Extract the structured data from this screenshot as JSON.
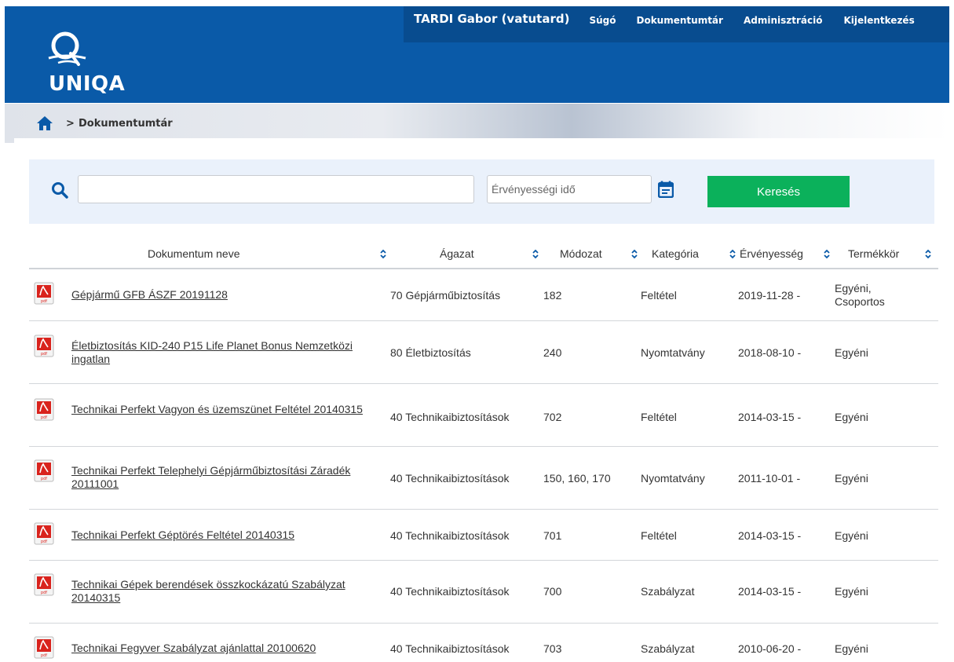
{
  "header": {
    "logo_text": "UNIQA",
    "user": "TARDI Gabor (vatutard)",
    "nav": [
      "Súgó",
      "Dokumentumtár",
      "Adminisztráció",
      "Kijelentkezés"
    ]
  },
  "breadcrumb": {
    "separator": ">",
    "current": "Dokumentumtár"
  },
  "search": {
    "query": "",
    "date_placeholder": "Érvényességi idő",
    "button_label": "Keresés"
  },
  "table": {
    "columns": [
      "Dokumentum neve",
      "Ágazat",
      "Módozat",
      "Kategória",
      "Érvényesség",
      "Termékkör"
    ],
    "rows": [
      {
        "name": "Gépjármű GFB ÁSZF 20191128",
        "agazat": "70 Gépjárműbiztosítás",
        "modozat": "182",
        "kategoria": "Feltétel",
        "ervenyesseg": "2019-11-28 -",
        "termekkor": "Egyéni, Csoportos"
      },
      {
        "name": "Életbiztosítás KID-240 P15 Life Planet Bonus Nemzetközi ingatlan",
        "agazat": "80 Életbiztosítás",
        "modozat": "240",
        "kategoria": "Nyomtatvány",
        "ervenyesseg": "2018-08-10 -",
        "termekkor": "Egyéni"
      },
      {
        "name": "Technikai Perfekt Vagyon és üzemszünet Feltétel 20140315",
        "agazat": "40 Technikaibiztosítások",
        "modozat": "702",
        "kategoria": "Feltétel",
        "ervenyesseg": "2014-03-15 -",
        "termekkor": "Egyéni"
      },
      {
        "name": "Technikai Perfekt Telephelyi Gépjárműbiztosítási Záradék 20111001",
        "agazat": "40 Technikaibiztosítások",
        "modozat": "150, 160, 170",
        "kategoria": "Nyomtatvány",
        "ervenyesseg": "2011-10-01 -",
        "termekkor": "Egyéni"
      },
      {
        "name": "Technikai Perfekt Géptörés Feltétel 20140315",
        "agazat": "40 Technikaibiztosítások",
        "modozat": "701",
        "kategoria": "Feltétel",
        "ervenyesseg": "2014-03-15 -",
        "termekkor": "Egyéni"
      },
      {
        "name": "Technikai Gépek berendések összkockázatú Szabályzat 20140315",
        "agazat": "40 Technikaibiztosítások",
        "modozat": "700",
        "kategoria": "Szabályzat",
        "ervenyesseg": "2014-03-15 -",
        "termekkor": "Egyéni"
      },
      {
        "name": "Technikai Fegyver Szabályzat ajánlattal 20100620",
        "agazat": "40 Technikaibiztosítások",
        "modozat": "703",
        "kategoria": "Szabályzat",
        "ervenyesseg": "2010-06-20 -",
        "termekkor": "Egyéni"
      }
    ]
  },
  "icons": {
    "file": "pdf-file-icon",
    "sort": "sort-icon",
    "search": "search-icon",
    "calendar": "calendar-icon",
    "home": "home-icon"
  },
  "colors": {
    "header_blue": "#0a5aa8",
    "nav_blue": "#084c8f",
    "button_green": "#0bb15b",
    "search_panel": "#eaf1fb"
  }
}
